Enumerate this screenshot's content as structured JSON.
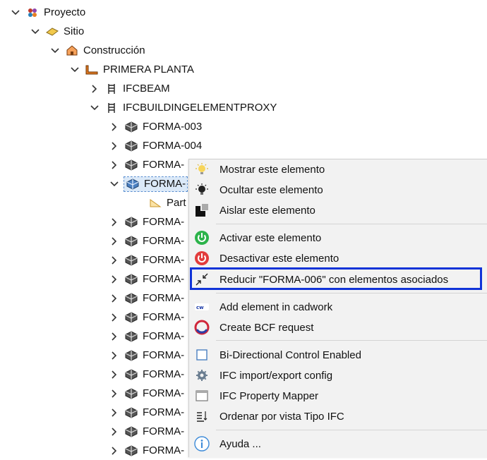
{
  "tree": {
    "proyecto": "Proyecto",
    "sitio": "Sitio",
    "construccion": "Construcción",
    "planta": "PRIMERA PLANTA",
    "ifcbeam": "IFCBEAM",
    "proxy": "IFCBUILDINGELEMENTPROXY",
    "forma003": "FORMA-003",
    "forma004": "FORMA-004",
    "forma_trunc": "FORMA-",
    "part": "Part"
  },
  "context_menu": {
    "items": [
      {
        "label": "Mostrar este elemento",
        "icon": "lightbulb-on-icon"
      },
      {
        "label": "Ocultar este elemento",
        "icon": "lightbulb-off-icon"
      },
      {
        "label": "Aislar este elemento",
        "icon": "isolate-icon"
      },
      {
        "label": "Activar este elemento",
        "icon": "power-on-icon"
      },
      {
        "label": "Desactivar este elemento",
        "icon": "power-off-icon"
      },
      {
        "label": "Reducir \"FORMA-006\" con elementos asociados",
        "icon": "collapse-arrows-icon"
      },
      {
        "label": "Add element in cadwork",
        "icon": "cadwork-icon"
      },
      {
        "label": "Create BCF request",
        "icon": "bcf-icon"
      },
      {
        "label": "Bi-Directional Control Enabled",
        "icon": "square-icon"
      },
      {
        "label": "IFC import/export config",
        "icon": "gear-icon"
      },
      {
        "label": "IFC Property Mapper",
        "icon": "window-icon"
      },
      {
        "label": "Ordenar por vista Tipo IFC",
        "icon": "sort-icon"
      },
      {
        "label": "Ayuda ...",
        "icon": "info-icon"
      }
    ]
  },
  "colors": {
    "highlight_border": "#1033d8",
    "menu_bg": "#f2f2f2",
    "selection_bg": "#dbe9f8"
  }
}
